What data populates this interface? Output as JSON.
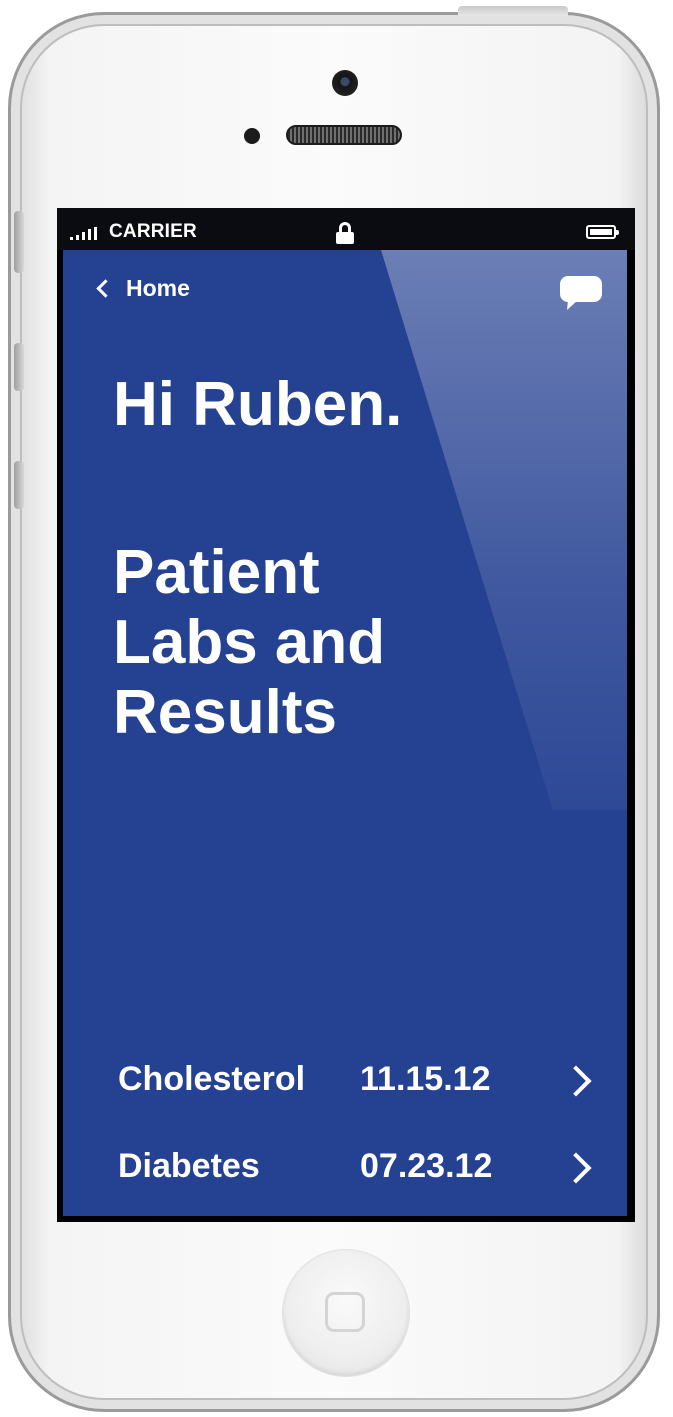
{
  "status_bar": {
    "carrier": "CARRIER",
    "lock_icon": "lock-icon",
    "battery_icon": "battery-icon"
  },
  "nav": {
    "back_label": "Home",
    "chat_icon": "chat-bubble-icon"
  },
  "main": {
    "greeting": "Hi Ruben.",
    "title_lines": [
      "Patient",
      "Labs and",
      "Results"
    ]
  },
  "results": [
    {
      "name": "Cholesterol",
      "date": "11.15.12"
    },
    {
      "name": "Diabetes",
      "date": "07.23.12"
    }
  ],
  "colors": {
    "app_background": "#254192",
    "text": "#ffffff",
    "status_bar": "#0b0c12"
  }
}
